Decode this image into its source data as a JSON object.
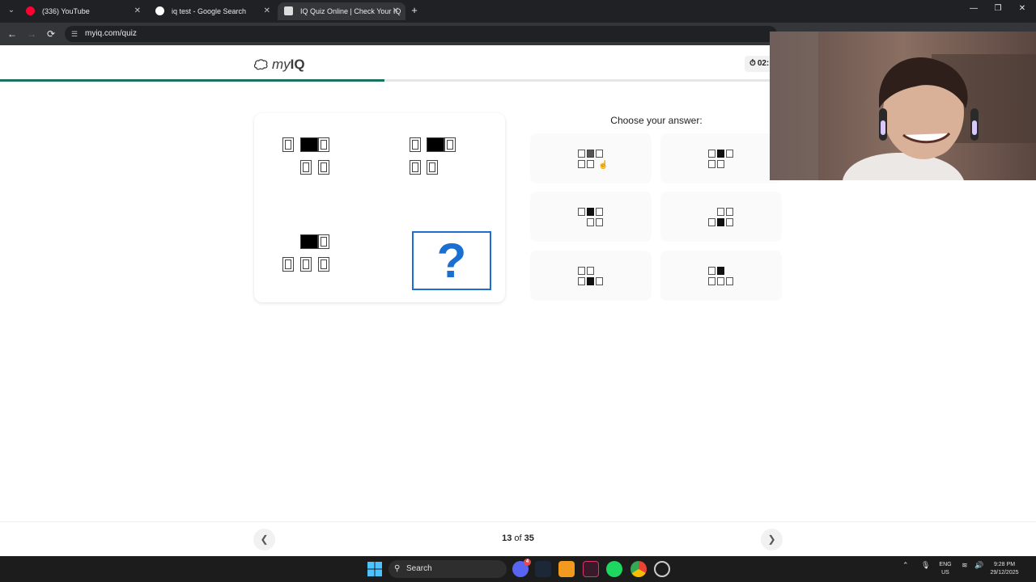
{
  "browser": {
    "tabs": [
      {
        "title": "(336) YouTube",
        "favicon_color": "#ff0033"
      },
      {
        "title": "iq test - Google Search",
        "favicon_color": "#ffffff"
      },
      {
        "title": "IQ Quiz Online | Check Your IQ",
        "favicon_color": "#dddddd"
      }
    ],
    "new_tab_label": "+",
    "url": "myiq.com/quiz"
  },
  "site": {
    "logo_my": "my",
    "logo_iq": "IQ",
    "timer": "02:",
    "progress": 0.371
  },
  "puzzle": {
    "question_mark": "?"
  },
  "answers": {
    "prompt": "Choose your answer:"
  },
  "pager": {
    "current": "13",
    "separator": "of",
    "total": "35",
    "prev_icon": "chevron-left-icon",
    "next_icon": "chevron-right-icon"
  },
  "taskbar": {
    "search_label": "Search",
    "lang_line1": "ENG",
    "lang_line2": "US",
    "time": "9:28 PM",
    "date": "29/12/2025",
    "discord_badge": "4"
  },
  "colors": {
    "accent": "#1a6fd1",
    "progress": "#19715f"
  }
}
